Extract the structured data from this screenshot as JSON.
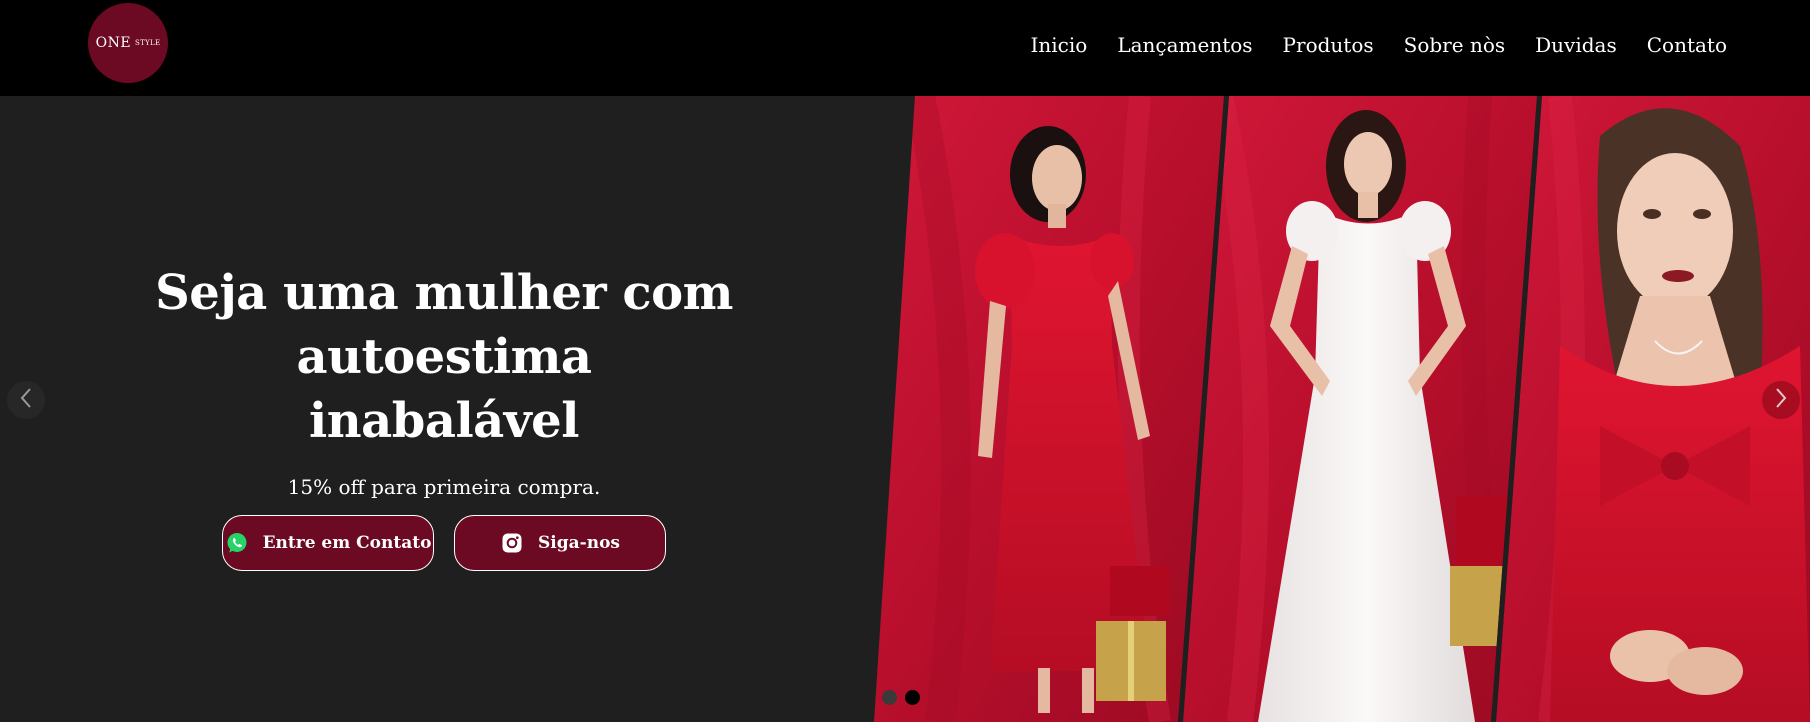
{
  "brand": {
    "logo_main": "ONE",
    "logo_sub": "STYLE",
    "color": "#6b0a22"
  },
  "nav": {
    "items": [
      "Inicio",
      "Lançamentos",
      "Produtos",
      "Sobre nòs",
      "Duvidas",
      "Contato"
    ]
  },
  "hero": {
    "title_line1": "Seja uma mulher com autoestima",
    "title_line2": "inabalável",
    "subtitle": "15% off para primeira compra.",
    "contact_button": "Entre em Contato",
    "follow_button": "Siga-nos",
    "contact_icon": "whatsapp-icon",
    "follow_icon": "instagram-icon"
  },
  "gallery": {
    "photos": [
      "red-dress-photo",
      "white-dress-photo",
      "red-dress-closeup-photo"
    ],
    "background_color": "#c8102e"
  },
  "carousel": {
    "slide_count": 2,
    "active_slide": 2,
    "prev_icon": "chevron-left-icon",
    "next_icon": "chevron-right-icon"
  }
}
